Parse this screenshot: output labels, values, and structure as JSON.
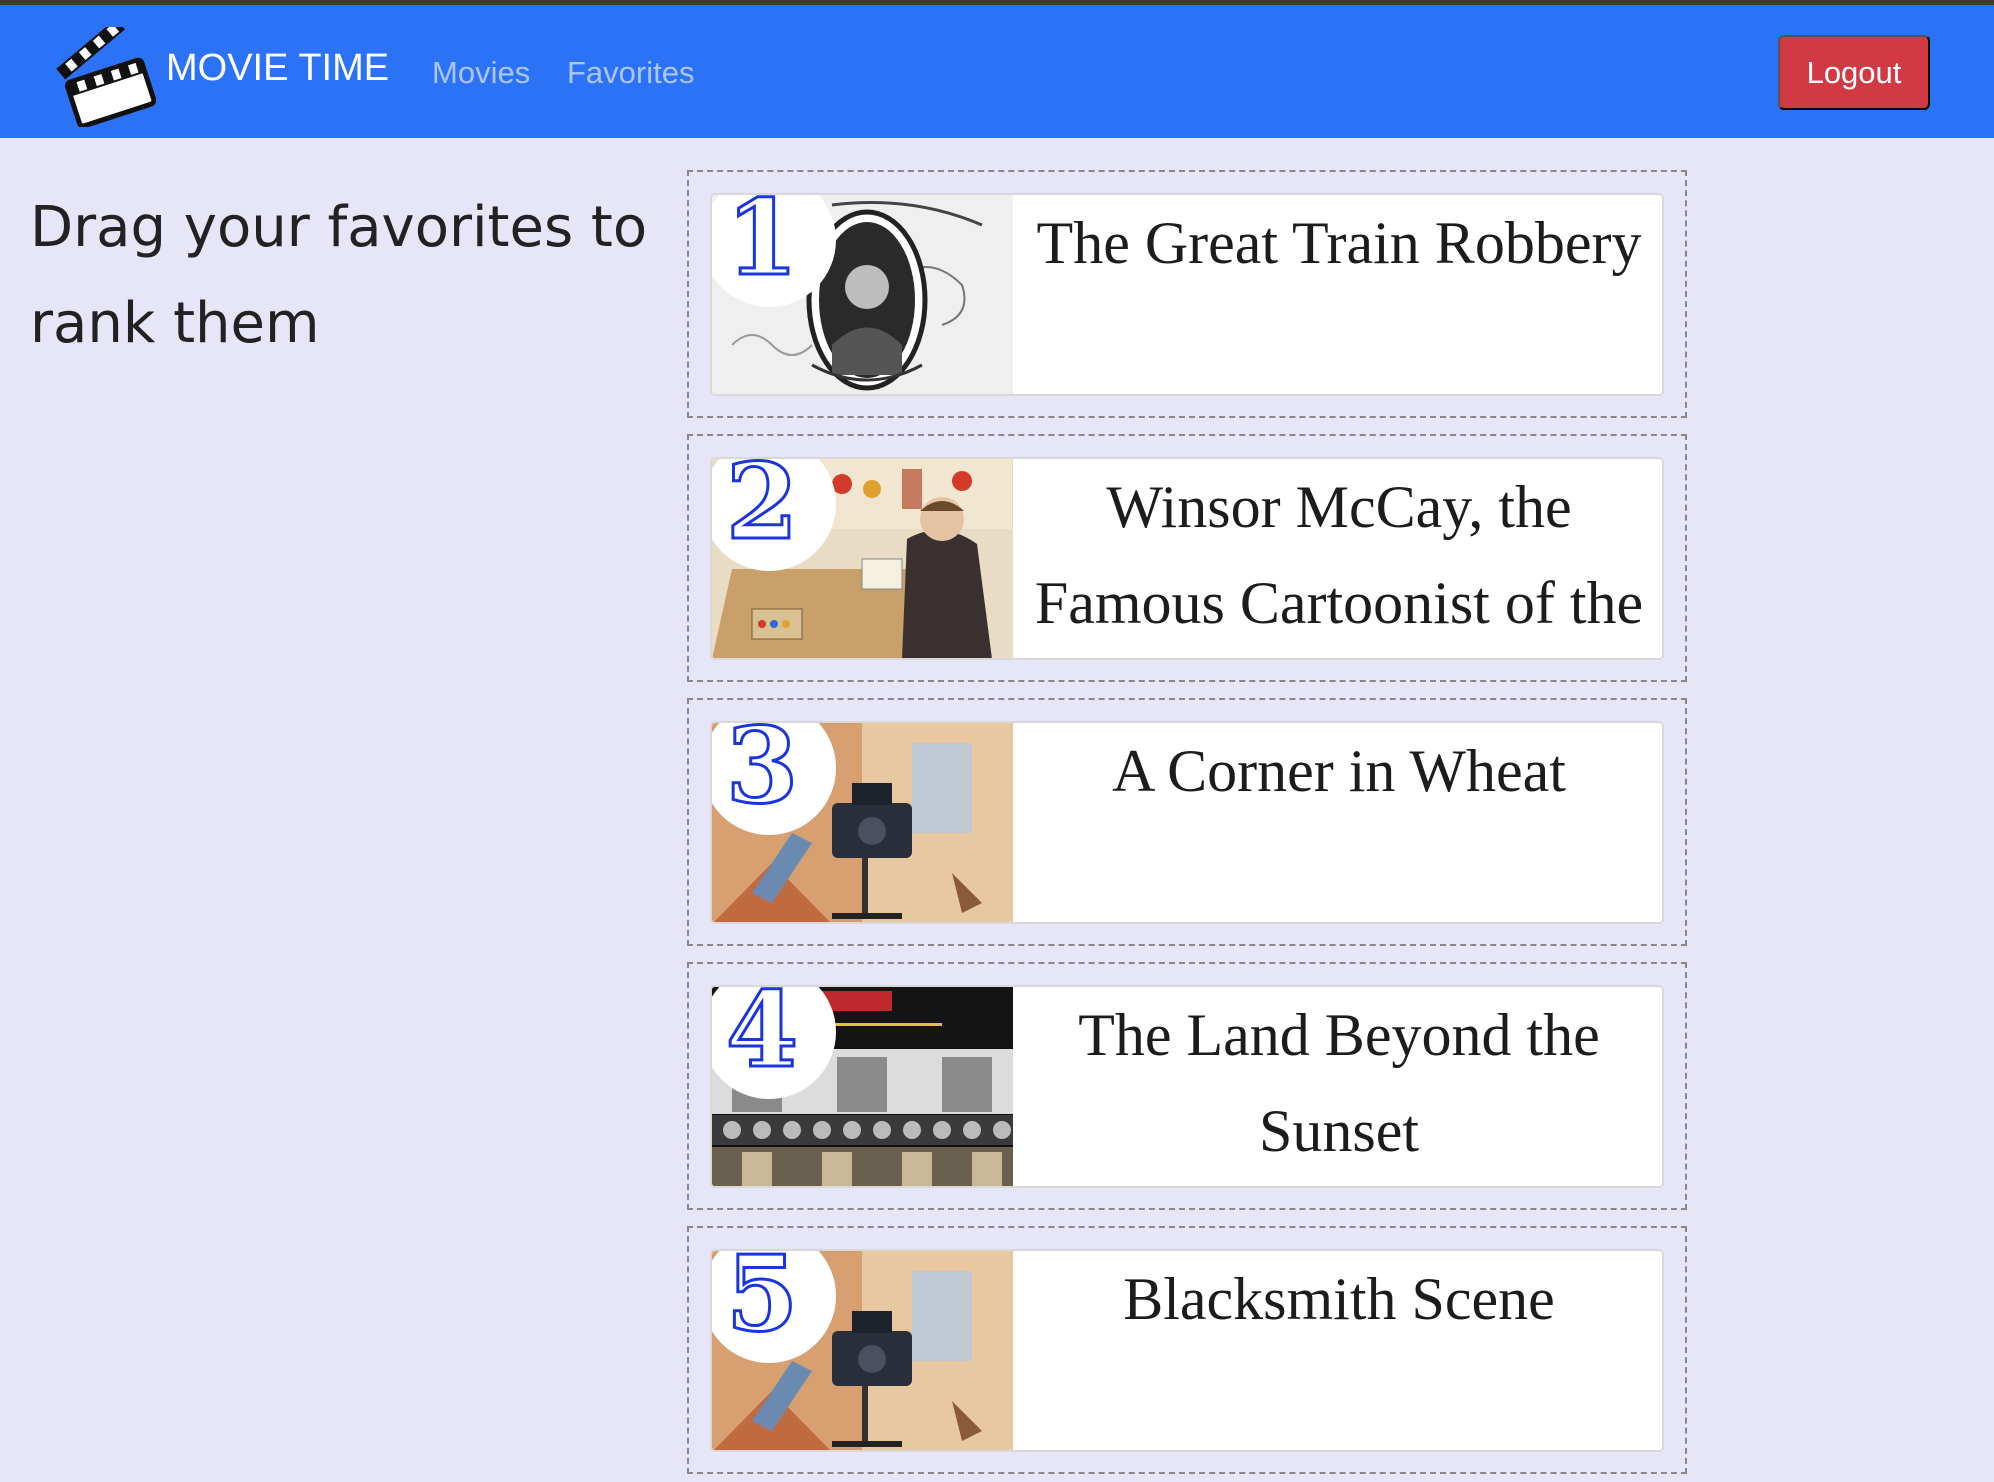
{
  "navbar": {
    "brand": "MOVIE TIME",
    "links": [
      "Movies",
      "Favorites"
    ],
    "logout_label": "Logout",
    "bg_color": "#2c72f6",
    "logout_color": "#d13a44",
    "logo_icon": "clapperboard-icon"
  },
  "sidebar": {
    "instructions": "Drag your favorites to rank them"
  },
  "favorites": [
    {
      "rank": "1",
      "title": "The Great Train Robbery"
    },
    {
      "rank": "2",
      "title": "Winsor McCay, the Famous Cartoonist of the"
    },
    {
      "rank": "3",
      "title": "A Corner in Wheat"
    },
    {
      "rank": "4",
      "title": "The Land Beyond the Sunset"
    },
    {
      "rank": "5",
      "title": "Blacksmith Scene"
    }
  ],
  "rank_color": "#1a35e0"
}
